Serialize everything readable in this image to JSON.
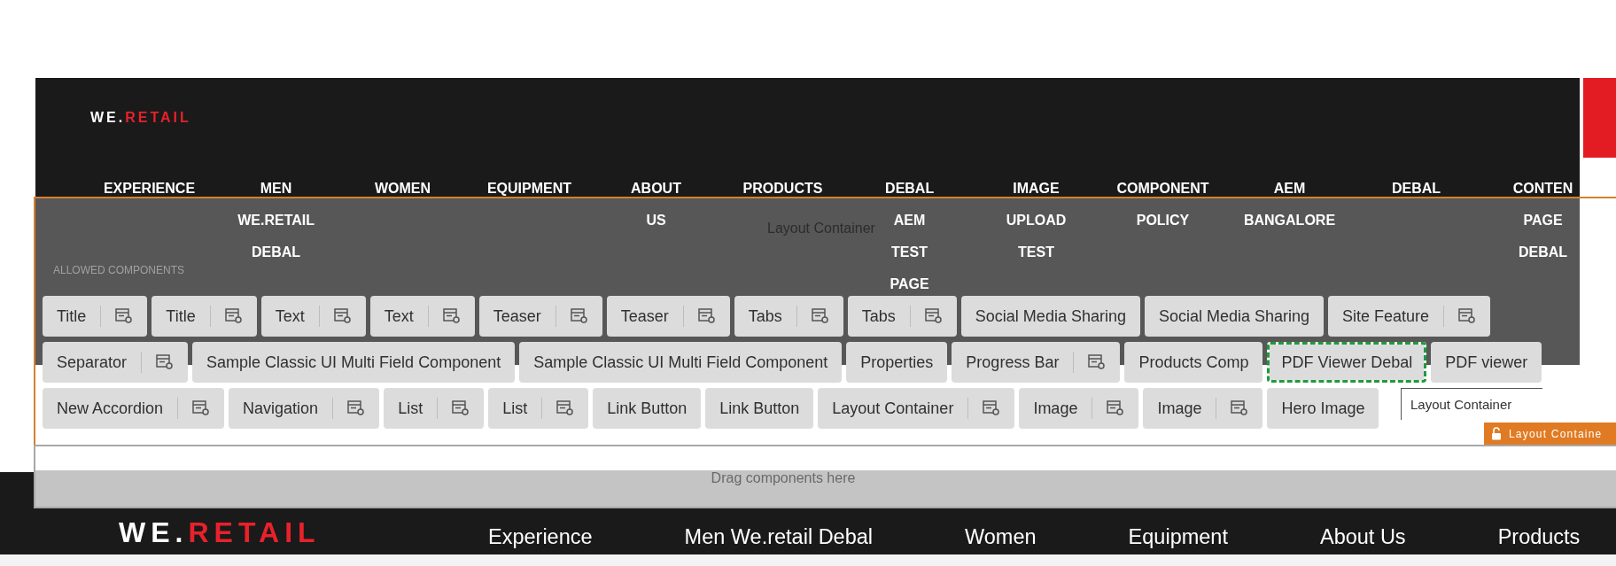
{
  "header": {
    "logo": {
      "prefix": "WE.",
      "accent": "RETAIL"
    },
    "nav": [
      {
        "label": "EXPERIENCE"
      },
      {
        "label": "MEN WE.RETAIL DEBAL"
      },
      {
        "label": "WOMEN"
      },
      {
        "label": "EQUIPMENT"
      },
      {
        "label": "ABOUT US"
      },
      {
        "label": "PRODUCTS"
      },
      {
        "label": "DEBAL AEM TEST PAGE"
      },
      {
        "label": "IMAGE UPLOAD TEST"
      },
      {
        "label": "COMPONENT POLICY"
      },
      {
        "label": "AEM BANGALORE"
      },
      {
        "label": "DEBAL"
      },
      {
        "label": "CONTEN PAGE DEBAL"
      }
    ]
  },
  "editor": {
    "container_label": "Layout Container",
    "allowed_label": "ALLOWED COMPONENTS",
    "component_rows": [
      [
        {
          "label": "Title",
          "kind": "configurable",
          "selected": false
        },
        {
          "label": "Title",
          "kind": "configurable",
          "selected": false
        },
        {
          "label": "Text",
          "kind": "configurable",
          "selected": false
        },
        {
          "label": "Text",
          "kind": "configurable",
          "selected": false
        },
        {
          "label": "Teaser",
          "kind": "configurable",
          "selected": false
        },
        {
          "label": "Teaser",
          "kind": "configurable",
          "selected": false
        },
        {
          "label": "Tabs",
          "kind": "configurable",
          "selected": false
        },
        {
          "label": "Tabs",
          "kind": "configurable",
          "selected": false
        },
        {
          "label": "Social Media Sharing",
          "kind": "plain",
          "selected": false
        },
        {
          "label": "Social Media Sharing",
          "kind": "plain",
          "selected": false
        },
        {
          "label": "Site Feature",
          "kind": "configurable",
          "selected": false
        }
      ],
      [
        {
          "label": "Separator",
          "kind": "configurable",
          "selected": false
        },
        {
          "label": "Sample Classic UI Multi Field Component",
          "kind": "plain",
          "selected": false
        },
        {
          "label": "Sample Classic UI Multi Field Component",
          "kind": "plain",
          "selected": false
        },
        {
          "label": "Properties",
          "kind": "plain",
          "selected": false
        },
        {
          "label": "Progress Bar",
          "kind": "configurable",
          "selected": false
        },
        {
          "label": "Products Comp",
          "kind": "plain",
          "selected": false
        },
        {
          "label": "PDF Viewer Debal",
          "kind": "plain",
          "selected": true
        },
        {
          "label": "PDF viewer",
          "kind": "plain",
          "selected": false
        }
      ],
      [
        {
          "label": "New Accordion",
          "kind": "configurable",
          "selected": false
        },
        {
          "label": "Navigation",
          "kind": "configurable",
          "selected": false
        },
        {
          "label": "List",
          "kind": "configurable",
          "selected": false
        },
        {
          "label": "List",
          "kind": "configurable",
          "selected": false
        },
        {
          "label": "Link Button",
          "kind": "plain",
          "selected": false
        },
        {
          "label": "Link Button",
          "kind": "plain",
          "selected": false
        },
        {
          "label": "Layout Container",
          "kind": "configurable",
          "selected": false
        },
        {
          "label": "Image",
          "kind": "configurable",
          "selected": false
        },
        {
          "label": "Image",
          "kind": "configurable",
          "selected": false
        },
        {
          "label": "Hero Image",
          "kind": "plain",
          "selected": false
        }
      ]
    ],
    "tooltip": "Layout Container",
    "badge": "Layout Containe"
  },
  "drop_zone": {
    "placeholder": "Drag components here"
  },
  "footer": {
    "logo": {
      "prefix": "WE.",
      "accent": "RETAIL"
    },
    "nav": [
      "Experience",
      "Men We.retail Debal",
      "Women",
      "Equipment",
      "About Us",
      "Products"
    ]
  }
}
